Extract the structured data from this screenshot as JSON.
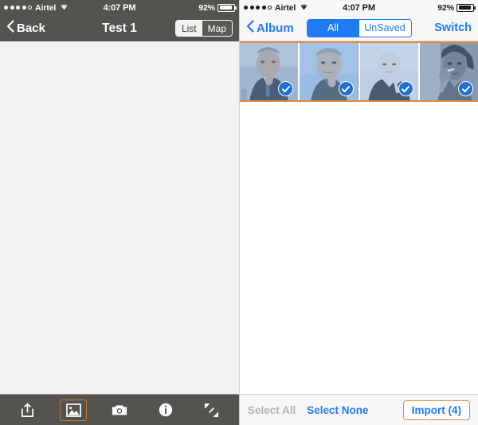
{
  "left": {
    "status": {
      "carrier": "Airtel",
      "signal_dots_filled": 4,
      "signal_dots_total": 5,
      "wifi_icon": "wifi-icon",
      "time": "4:07 PM",
      "battery_pct": "92%",
      "battery_icon": "battery-icon"
    },
    "nav": {
      "back_icon": "chevron-left-icon",
      "back_label": "Back",
      "title": "Test 1",
      "segments": [
        {
          "label": "List",
          "selected": false
        },
        {
          "label": "Map",
          "selected": true
        }
      ]
    },
    "toolbar": [
      {
        "icon": "share-icon",
        "selected": false
      },
      {
        "icon": "photo-icon",
        "selected": true
      },
      {
        "icon": "camera-icon",
        "selected": false
      },
      {
        "icon": "info-icon",
        "selected": false
      },
      {
        "icon": "fullscreen-icon",
        "selected": false
      }
    ]
  },
  "right": {
    "status": {
      "carrier": "Airtel",
      "signal_dots_filled": 4,
      "signal_dots_total": 5,
      "wifi_icon": "wifi-icon",
      "time": "4:07 PM",
      "battery_pct": "92%",
      "battery_icon": "battery-icon"
    },
    "nav": {
      "back_icon": "chevron-left-icon",
      "back_label": "Album",
      "segments": [
        {
          "label": "All",
          "selected": true
        },
        {
          "label": "UnSaved",
          "selected": false
        }
      ],
      "action_label": "Switch"
    },
    "photos": [
      {
        "alt": "portrait-man-suit",
        "selected": true,
        "check_icon": "check-circle-icon"
      },
      {
        "alt": "portrait-man-dark-shirt",
        "selected": true,
        "check_icon": "check-circle-icon"
      },
      {
        "alt": "portrait-woman-blonde",
        "selected": true,
        "check_icon": "check-circle-icon"
      },
      {
        "alt": "portrait-woman-smoking",
        "selected": true,
        "check_icon": "check-circle-icon"
      }
    ],
    "toolbar": {
      "select_all_label": "Select All",
      "select_all_enabled": false,
      "select_none_label": "Select None",
      "select_none_enabled": true,
      "import_label": "Import (4)"
    }
  },
  "colors": {
    "nav_dark": "#555350",
    "accent_blue": "#1f7bf6",
    "accent_orange": "#e0883b",
    "panel_bg_left": "#f2f1f0",
    "toolbar_light": "#f7f7f7"
  }
}
